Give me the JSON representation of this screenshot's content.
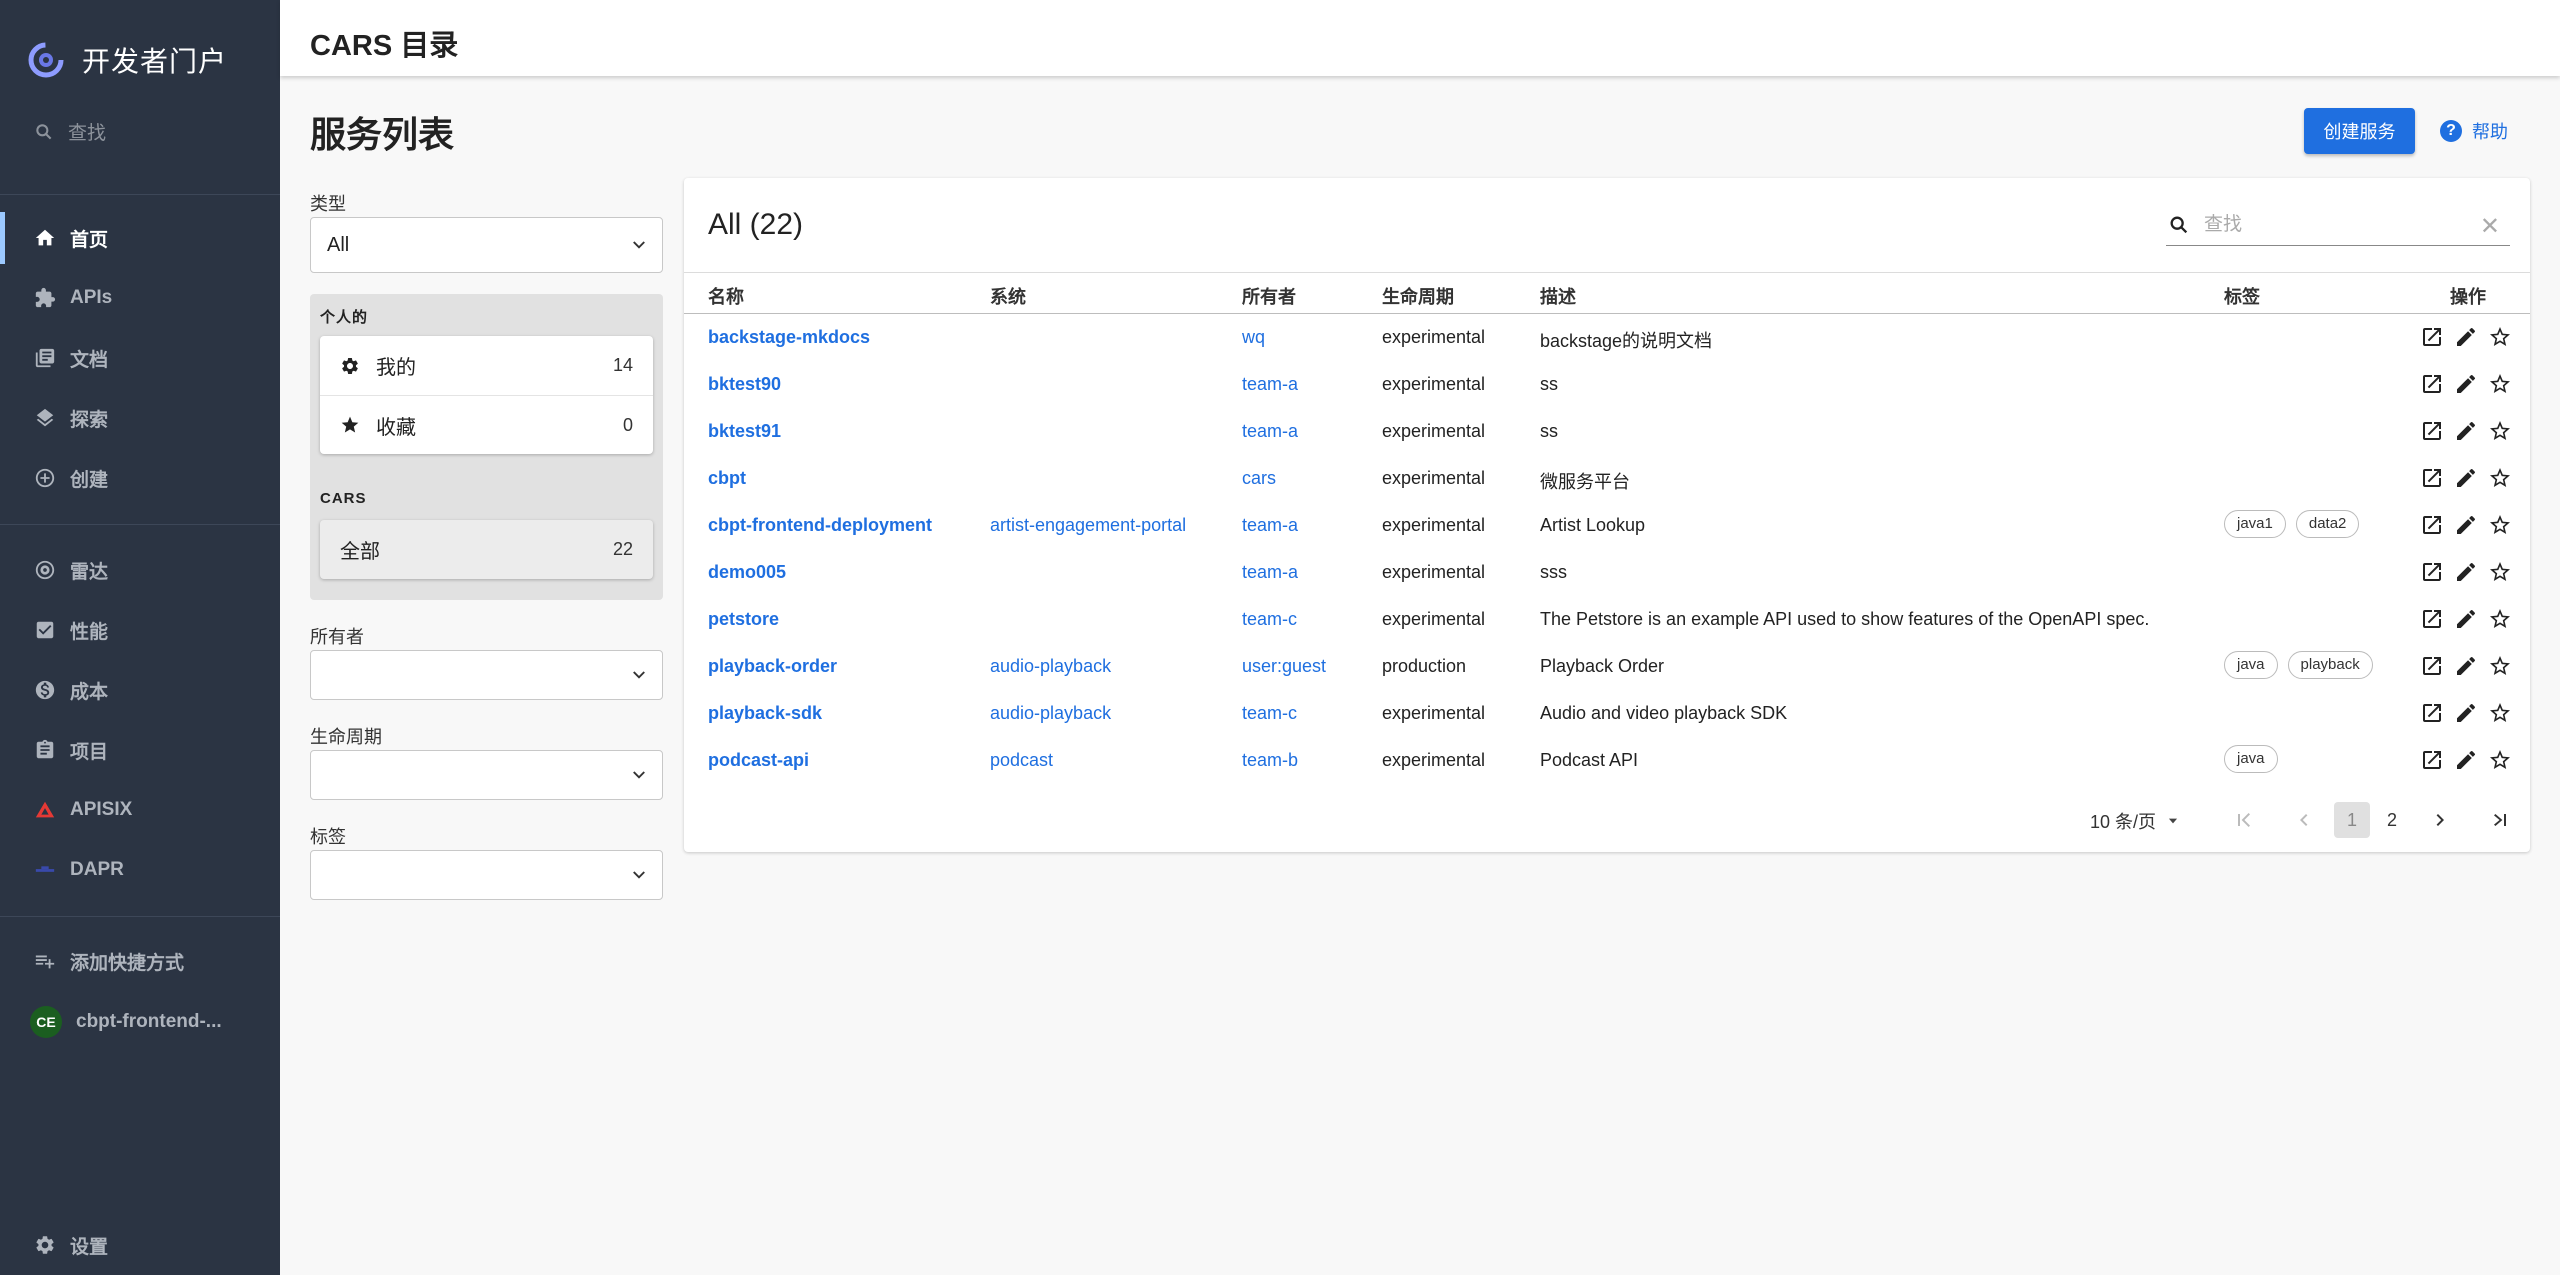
{
  "app": {
    "title": "开发者门户"
  },
  "sidebar": {
    "search": "查找",
    "items": [
      {
        "label": "首页",
        "icon": "home-icon",
        "active": true
      },
      {
        "label": "APIs",
        "icon": "puzzle-icon"
      },
      {
        "label": "文档",
        "icon": "docs-icon"
      },
      {
        "label": "探索",
        "icon": "layers-icon"
      },
      {
        "label": "创建",
        "icon": "add-circle-icon"
      },
      {
        "label": "雷达",
        "icon": "radar-icon"
      },
      {
        "label": "性能",
        "icon": "check-square-icon"
      },
      {
        "label": "成本",
        "icon": "dollar-icon"
      },
      {
        "label": "项目",
        "icon": "assignment-icon"
      },
      {
        "label": "APISIX",
        "icon": "apisix-icon"
      },
      {
        "label": "DAPR",
        "icon": "dapr-icon"
      }
    ],
    "add_shortcut": "添加快捷方式",
    "shortcut": {
      "avatar": "CE",
      "label": "cbpt-frontend-..."
    },
    "settings": "设置"
  },
  "header": {
    "title": "CARS 目录"
  },
  "page": {
    "title": "服务列表",
    "create_button": "创建服务",
    "help": "帮助"
  },
  "filters": {
    "type_label": "类型",
    "type_value": "All",
    "personal_heading": "个人的",
    "personal": [
      {
        "label": "我的",
        "count": "14",
        "icon": "gear-icon"
      },
      {
        "label": "收藏",
        "count": "0",
        "icon": "star-icon"
      }
    ],
    "org_heading": "CARS",
    "org": [
      {
        "label": "全部",
        "count": "22"
      }
    ],
    "owner_label": "所有者",
    "lifecycle_label": "生命周期",
    "tags_label": "标签"
  },
  "table": {
    "title": "All (22)",
    "search_placeholder": "查找",
    "columns": [
      "名称",
      "系统",
      "所有者",
      "生命周期",
      "描述",
      "标签",
      "操作"
    ],
    "rows": [
      {
        "name": "backstage-mkdocs",
        "system": "",
        "owner": "wq",
        "lifecycle": "experimental",
        "description": "backstage的说明文档",
        "tags": []
      },
      {
        "name": "bktest90",
        "system": "",
        "owner": "team-a",
        "lifecycle": "experimental",
        "description": "ss",
        "tags": []
      },
      {
        "name": "bktest91",
        "system": "",
        "owner": "team-a",
        "lifecycle": "experimental",
        "description": "ss",
        "tags": []
      },
      {
        "name": "cbpt",
        "system": "",
        "owner": "cars",
        "lifecycle": "experimental",
        "description": "微服务平台",
        "tags": []
      },
      {
        "name": "cbpt-frontend-deployment",
        "system": "artist-engagement-portal",
        "owner": "team-a",
        "lifecycle": "experimental",
        "description": "Artist Lookup",
        "tags": [
          "java1",
          "data2"
        ]
      },
      {
        "name": "demo005",
        "system": "",
        "owner": "team-a",
        "lifecycle": "experimental",
        "description": "sss",
        "tags": []
      },
      {
        "name": "petstore",
        "system": "",
        "owner": "team-c",
        "lifecycle": "experimental",
        "description": "The Petstore is an example API used to show features of the OpenAPI spec.",
        "tags": []
      },
      {
        "name": "playback-order",
        "system": "audio-playback",
        "owner": "user:guest",
        "lifecycle": "production",
        "description": "Playback Order",
        "tags": [
          "java",
          "playback"
        ]
      },
      {
        "name": "playback-sdk",
        "system": "audio-playback",
        "owner": "team-c",
        "lifecycle": "experimental",
        "description": "Audio and video playback SDK",
        "tags": []
      },
      {
        "name": "podcast-api",
        "system": "podcast",
        "owner": "team-b",
        "lifecycle": "experimental",
        "description": "Podcast API",
        "tags": [
          "java"
        ]
      }
    ],
    "pagination": {
      "rows_per_page": "10 条/页",
      "pages": [
        "1",
        "2"
      ],
      "current": "1"
    }
  },
  "colors": {
    "sidebar": "#2b3443",
    "accent": "#1f6fe0"
  }
}
